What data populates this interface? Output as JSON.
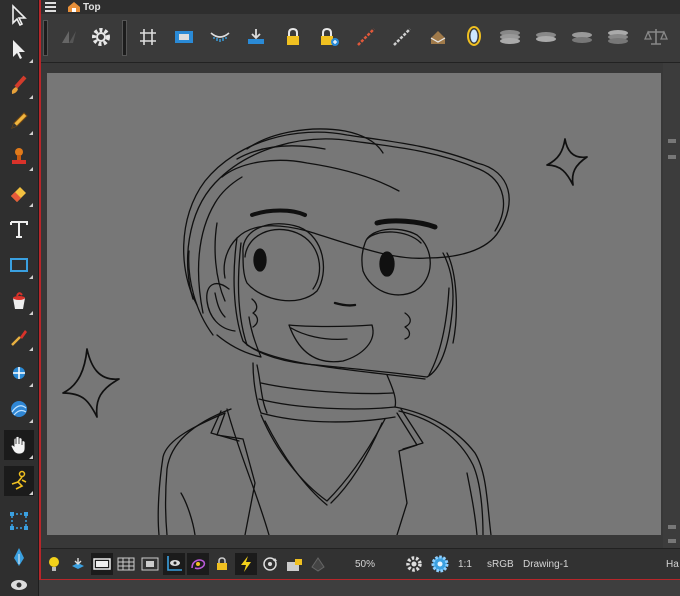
{
  "colors": {
    "frame_accent": "#b7262a",
    "canvas": "#777777",
    "panel": "#3a3a3a",
    "bolt": "#f3d21b"
  },
  "header": {
    "breadcrumb": "Top",
    "menu_icon": "hamburger-icon",
    "home_icon": "home-icon"
  },
  "left_tools": [
    {
      "icon": "select-arrow-icon"
    },
    {
      "icon": "contour-editor-icon"
    },
    {
      "icon": "brush-icon"
    },
    {
      "icon": "pencil-icon"
    },
    {
      "icon": "stamp-icon"
    },
    {
      "icon": "eraser-icon"
    },
    {
      "icon": "text-icon"
    },
    {
      "icon": "rectangle-icon"
    },
    {
      "icon": "paint-bucket-icon"
    },
    {
      "icon": "dropper-icon"
    },
    {
      "icon": "pivot-icon"
    },
    {
      "icon": "sphere-icon"
    },
    {
      "icon": "hand-icon"
    },
    {
      "icon": "rigging-icon"
    },
    {
      "icon": "transform-box-icon"
    },
    {
      "icon": "pen-icon"
    },
    {
      "icon": "eye-icon"
    }
  ],
  "view_toolbar": {
    "icons": [
      "onion-skin-icon",
      "settings-gear-icon",
      "grid-icon",
      "camera-mask-icon",
      "light-table-icon",
      "export-icon",
      "lock-icon",
      "lock-add-icon",
      "bone-icon",
      "bone-alt-icon",
      "envelope-icon",
      "mirror-icon",
      "layer-stack-icon",
      "layer-flat-icon",
      "layer-down-icon",
      "layer-up-icon",
      "balance-icon"
    ]
  },
  "status_bar": {
    "zoom": "50%",
    "ratio": "1:1",
    "color_space": "sRGB",
    "drawing_name": "Drawing-1",
    "trailing": "Ha",
    "icons": [
      "bulb-icon",
      "layer-icon",
      "preview-icon",
      "table-icon",
      "safe-area-icon",
      "camera-view-icon",
      "onion-toggle-icon",
      "lock-small-icon",
      "bolt-icon",
      "rotate-icon",
      "cam-lock-icon",
      "render-icon",
      "gear-small-icon",
      "flower-icon"
    ]
  }
}
